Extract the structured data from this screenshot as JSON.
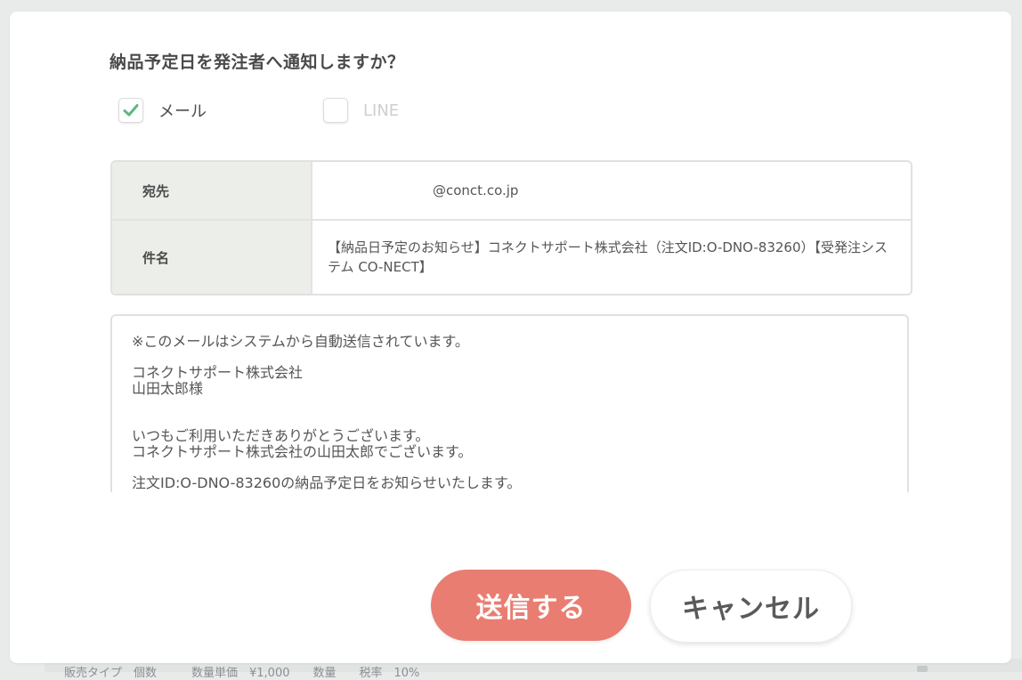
{
  "background": {
    "footer_text": "販売タイプ　個数　　　数量単価　¥1,000　　数量　　税率　10%"
  },
  "dialog": {
    "title": "納品予定日を発注者へ通知しますか？",
    "channels": [
      {
        "label": "メール",
        "checked": true
      },
      {
        "label": "LINE",
        "checked": false
      }
    ],
    "to_label": "宛先",
    "to_value": "@conct.co.jp",
    "subject_label": "件名",
    "subject_value": "【納品日予定のお知らせ】コネクトサポート株式会社（注文ID:O-DNO-83260）【受発注システム CO-NECT】",
    "body_paragraphs": [
      "※このメールはシステムから自動送信されています。",
      "コネクトサポート株式会社\n山田太郎様",
      "\nいつもご利用いただきありがとうございます。\nコネクトサポート株式会社の山田太郎でございます。",
      "注文ID:O-DNO-83260の納品予定日をお知らせいたします。"
    ],
    "send_label": "送信する",
    "cancel_label": "キャンセル"
  },
  "colors": {
    "accent": "#e97d71",
    "check": "#5cb87a"
  }
}
